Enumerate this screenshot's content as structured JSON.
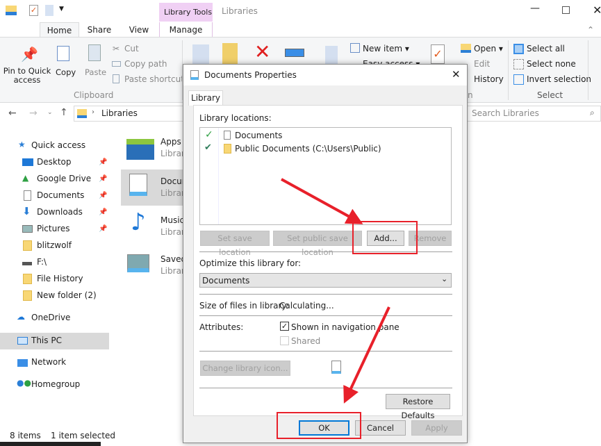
{
  "window": {
    "title": "Libraries",
    "context_tab_group": "Library Tools"
  },
  "ribbon_tabs": [
    {
      "label": "Home"
    },
    {
      "label": "Share"
    },
    {
      "label": "View"
    },
    {
      "label": "Manage"
    }
  ],
  "clipboard": {
    "pin": "Pin to Quick access",
    "pin_l1": "Pin to Quick",
    "pin_l2": "access",
    "copy": "Copy",
    "paste": "Paste",
    "cut": "Cut",
    "copy_path": "Copy path",
    "paste_shortcut": "Paste shortcut",
    "group": "Clipboard"
  },
  "new_group": {
    "new_item": "New item",
    "easy_access": "Easy access"
  },
  "open_group": {
    "open": "Open",
    "edit": "Edit",
    "history": "History",
    "group_tail": "n"
  },
  "select_group": {
    "select_all": "Select all",
    "select_none": "Select none",
    "invert": "Invert selection",
    "group": "Select"
  },
  "address": {
    "crumb": "Libraries",
    "search_placeholder": "Search Libraries"
  },
  "nav": {
    "quick_access": "Quick access",
    "items": [
      {
        "label": "Desktop",
        "pinned": true
      },
      {
        "label": "Google Drive",
        "pinned": true
      },
      {
        "label": "Documents",
        "pinned": true
      },
      {
        "label": "Downloads",
        "pinned": true
      },
      {
        "label": "Pictures",
        "pinned": true
      },
      {
        "label": "blitzwolf"
      },
      {
        "label": "F:\\"
      },
      {
        "label": "File History"
      },
      {
        "label": "New folder (2)"
      }
    ],
    "onedrive": "OneDrive",
    "this_pc": "This PC",
    "network": "Network",
    "homegroup": "Homegroup"
  },
  "libraries": [
    {
      "name": "Apps",
      "type": "Library"
    },
    {
      "name": "Documents",
      "type": "Library"
    },
    {
      "name": "Music",
      "type": "Library"
    },
    {
      "name": "Saved Pictures",
      "type": "Library"
    }
  ],
  "status": {
    "count": "8 items",
    "selected": "1 item selected"
  },
  "dialog": {
    "title": "Documents Properties",
    "tab": "Library",
    "locations_label": "Library locations:",
    "locations": [
      {
        "name": "Documents",
        "default": true
      },
      {
        "name": "Public Documents (C:\\Users\\Public)",
        "public": true
      }
    ],
    "set_save": "Set save location",
    "set_public": "Set public save location",
    "add": "Add...",
    "remove": "Remove",
    "optimize_label": "Optimize this library for:",
    "optimize_value": "Documents",
    "size_label": "Size of files in library:",
    "size_value": "Calculating...",
    "attributes_label": "Attributes:",
    "shown_in_nav": "Shown in navigation pane",
    "shown_checked": true,
    "shared": "Shared",
    "shared_checked": false,
    "change_icon": "Change library icon...",
    "restore": "Restore Defaults",
    "ok": "OK",
    "cancel": "Cancel",
    "apply": "Apply"
  },
  "colors": {
    "annotation": "#e8202a",
    "context_tab": "#f0d0f4",
    "selection": "#d9d9d9",
    "accent": "#0078d7"
  }
}
